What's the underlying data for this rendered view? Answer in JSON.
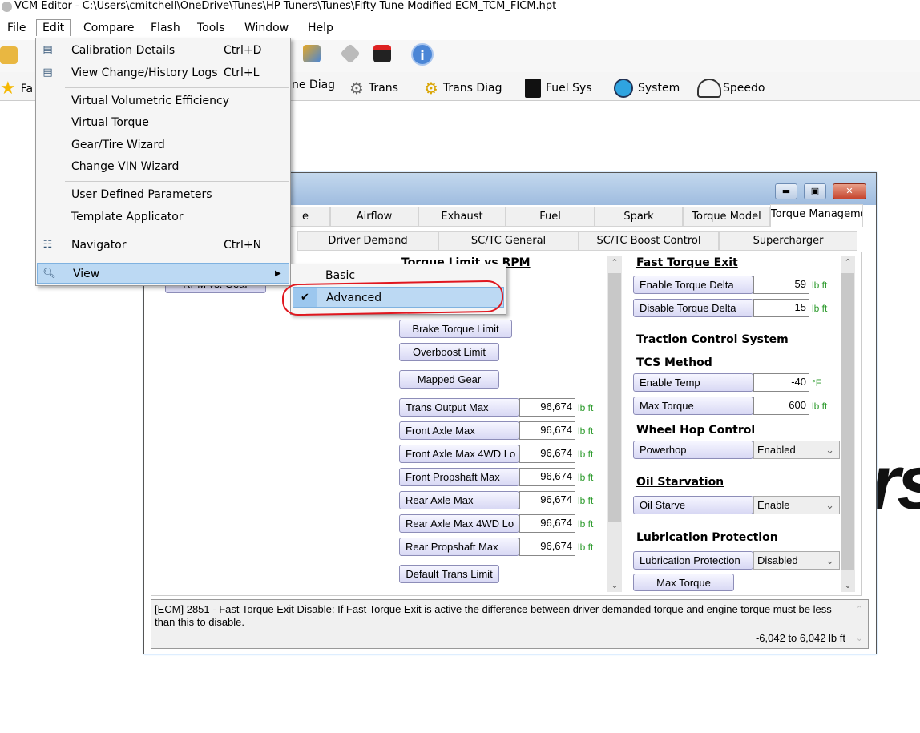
{
  "app_title": "VCM Editor - C:\\Users\\cmitchell\\OneDrive\\Tunes\\HP Tuners\\Tunes\\Fifty Tune Modified ECM_TCM_FICM.hpt",
  "menubar": [
    "File",
    "Edit",
    "Compare",
    "Flash",
    "Tools",
    "Window",
    "Help"
  ],
  "toolbar2": {
    "favorites": "Fa",
    "engine_diag": "ne Diag",
    "trans": "Trans",
    "trans_diag": "Trans Diag",
    "fuel_sys": "Fuel Sys",
    "system": "System",
    "speedo": "Speedo"
  },
  "edit_menu": {
    "items": [
      {
        "label": "Calibration Details",
        "shortcut": "Ctrl+D",
        "icon": "calibration-info-icon"
      },
      {
        "label": "View Change/History Logs",
        "shortcut": "Ctrl+L",
        "icon": "history-log-icon"
      },
      {
        "label": "Virtual Volumetric Efficiency"
      },
      {
        "label": "Virtual Torque"
      },
      {
        "label": "Gear/Tire Wizard"
      },
      {
        "label": "Change VIN Wizard"
      },
      {
        "label": "User Defined Parameters"
      },
      {
        "label": "Template Applicator"
      },
      {
        "label": "Navigator",
        "shortcut": "Ctrl+N",
        "icon": "navigator-icon"
      },
      {
        "label": "View",
        "icon": "magnifier-icon"
      }
    ]
  },
  "view_submenu": {
    "items": [
      {
        "label": "Basic",
        "checked": false
      },
      {
        "label": "Advanced",
        "checked": true
      }
    ]
  },
  "editor_window": {
    "tabs_row1": [
      "e",
      "Airflow",
      "Exhaust",
      "Fuel",
      "Spark",
      "Torque Model",
      "Torque Manageme"
    ],
    "selected_tab": "Torque Manageme",
    "tabs_row2": [
      "Driver Demand",
      "SC/TC General",
      "SC/TC Boost Control",
      "Supercharger"
    ],
    "left_button": "RPM vs. Gear",
    "middle": {
      "heading": "Torque Limit vs RPM",
      "buttons": [
        "Brake Torque Limit",
        "Overboost Limit",
        "Mapped Gear"
      ],
      "rows": [
        {
          "label": "Trans Output Max",
          "value": "96,674",
          "unit": "lb ft"
        },
        {
          "label": "Front Axle Max",
          "value": "96,674",
          "unit": "lb ft"
        },
        {
          "label": "Front Axle Max 4WD Lo",
          "value": "96,674",
          "unit": "lb ft"
        },
        {
          "label": "Front Propshaft Max",
          "value": "96,674",
          "unit": "lb ft"
        },
        {
          "label": "Rear Axle Max",
          "value": "96,674",
          "unit": "lb ft"
        },
        {
          "label": "Rear Axle Max 4WD Lo",
          "value": "96,674",
          "unit": "lb ft"
        },
        {
          "label": "Rear Propshaft Max",
          "value": "96,674",
          "unit": "lb ft"
        }
      ],
      "footer_button": "Default Trans Limit"
    },
    "right": {
      "fast_torque_exit": {
        "heading": "Fast Torque Exit",
        "rows": [
          {
            "label": "Enable Torque Delta",
            "value": "59",
            "unit": "lb ft"
          },
          {
            "label": "Disable Torque Delta",
            "value": "15",
            "unit": "lb ft"
          }
        ]
      },
      "tcs": {
        "heading": "Traction Control System",
        "method": "TCS Method",
        "rows": [
          {
            "label": "Enable Temp",
            "value": "-40",
            "unit": "°F"
          },
          {
            "label": "Max Torque",
            "value": "600",
            "unit": "lb ft"
          }
        ]
      },
      "wheel_hop": {
        "heading": "Wheel Hop Control",
        "label": "Powerhop",
        "value": "Enabled"
      },
      "oil_starvation": {
        "heading": "Oil Starvation",
        "label": "Oil Starve",
        "value": "Enable"
      },
      "lubrication": {
        "heading": "Lubrication Protection",
        "label": "Lubrication Protection",
        "value": "Disabled",
        "button": "Max Torque"
      }
    },
    "status": {
      "text": "[ECM] 2851 - Fast Torque Exit Disable: If Fast Torque Exit is active the difference between driver demanded torque and engine torque must be less than this to disable.",
      "range": "-6,042 to 6,042 lb ft"
    }
  },
  "background_logo": "rs",
  "colors": {
    "highlight": "#bcd9f3",
    "annotation": "#e0171f",
    "unit": "#2a9a2a"
  }
}
